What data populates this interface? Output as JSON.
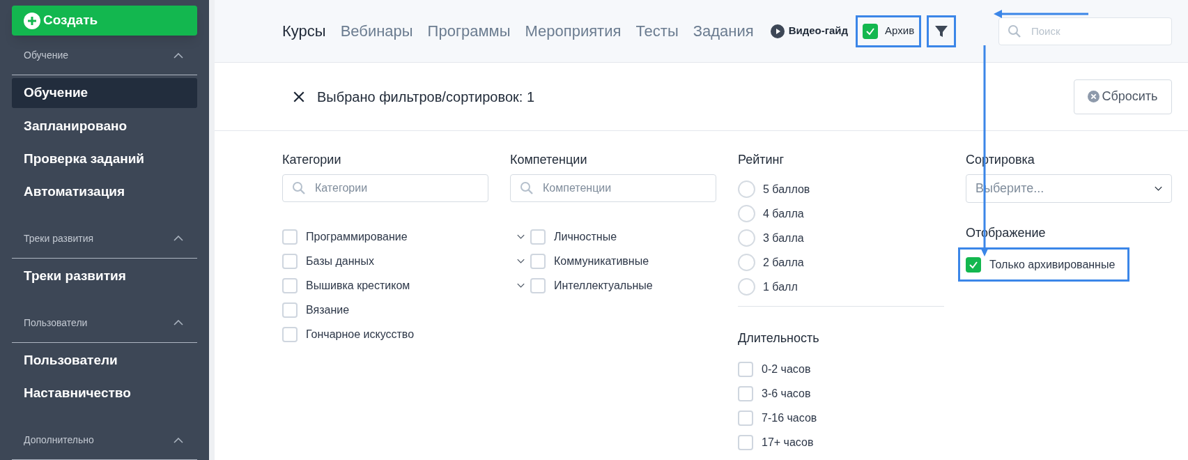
{
  "sidebar": {
    "create_button": "Создать",
    "sections": [
      {
        "title": "Обучение",
        "expanded": true,
        "items": [
          {
            "label": "Обучение",
            "selected": true
          },
          {
            "label": "Запланировано",
            "selected": false
          },
          {
            "label": "Проверка заданий",
            "selected": false
          },
          {
            "label": "Автоматизация",
            "selected": false
          }
        ]
      },
      {
        "title": "Треки развития",
        "expanded": true,
        "items": [
          {
            "label": "Треки развития",
            "selected": false
          }
        ]
      },
      {
        "title": "Пользователи",
        "expanded": true,
        "items": [
          {
            "label": "Пользователи",
            "selected": false
          },
          {
            "label": "Наставничество",
            "selected": false
          }
        ]
      },
      {
        "title": "Дополнительно",
        "expanded": true
      }
    ]
  },
  "top_tabs": [
    {
      "label": "Курсы",
      "selected": true
    },
    {
      "label": "Вебинары",
      "selected": false
    },
    {
      "label": "Программы",
      "selected": false
    },
    {
      "label": "Мероприятия",
      "selected": false
    },
    {
      "label": "Тесты",
      "selected": false
    },
    {
      "label": "Задания",
      "selected": false
    }
  ],
  "video_guide": "Видео-гайд",
  "archive_toggle": {
    "label": "Архив",
    "checked": true,
    "highlighted": true
  },
  "filter_button": {
    "highlighted": true
  },
  "search": {
    "placeholder": "Поиск"
  },
  "filter_panel": {
    "title": "Выбрано фильтров/сортировок: 1",
    "reset_button": "Сбросить",
    "categories": {
      "title": "Категории",
      "placeholder": "Категории",
      "options": [
        {
          "label": "Программирование",
          "checked": false
        },
        {
          "label": "Базы данных",
          "checked": false
        },
        {
          "label": "Вышивка крестиком",
          "checked": false
        },
        {
          "label": "Вязание",
          "checked": false
        },
        {
          "label": "Гончарное искусство",
          "checked": false
        }
      ]
    },
    "competencies": {
      "title": "Компетенции",
      "placeholder": "Компетенции",
      "options": [
        {
          "label": "Личностные",
          "checked": false,
          "expanded": false
        },
        {
          "label": "Коммуникативные",
          "checked": false,
          "expanded": false
        },
        {
          "label": "Интеллектуальные",
          "checked": false,
          "expanded": false
        }
      ]
    },
    "rating": {
      "title": "Рейтинг",
      "options": [
        {
          "label": "5 баллов",
          "selected": false
        },
        {
          "label": "4 балла",
          "selected": false
        },
        {
          "label": "3 балла",
          "selected": false
        },
        {
          "label": "2 балла",
          "selected": false
        },
        {
          "label": "1 балл",
          "selected": false
        }
      ]
    },
    "duration": {
      "title": "Длительность",
      "options": [
        {
          "label": "0-2 часов",
          "checked": false
        },
        {
          "label": "3-6 часов",
          "checked": false
        },
        {
          "label": "7-16 часов",
          "checked": false
        },
        {
          "label": "17+ часов",
          "checked": false
        }
      ]
    },
    "sorting": {
      "title": "Сортировка",
      "placeholder": "Выберите..."
    },
    "display": {
      "title": "Отображение",
      "options": [
        {
          "label": "Только архивированные",
          "checked": true,
          "highlighted": true
        }
      ]
    }
  }
}
